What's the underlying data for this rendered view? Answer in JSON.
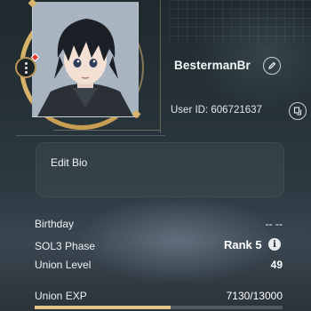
{
  "profile": {
    "username": "BestermanBr",
    "user_id": "User ID: 606721637",
    "edit_bio_label": "Edit Bio"
  },
  "stats": {
    "birthday_label": "Birthday",
    "birthday_value": "-- --",
    "phase_label": "SOL3 Phase",
    "phase_value": "Rank 5",
    "union_level_label": "Union Level",
    "union_level_value": "49",
    "union_exp_label": "Union EXP",
    "union_exp_value": "7130/13000",
    "union_exp_fraction": 0.548
  },
  "icons": {
    "options": "more-dots-icon",
    "rename": "pencil-icon",
    "copy_id": "copy-icon",
    "info": "info-icon"
  },
  "colors": {
    "accent_gold": "#d8b46a",
    "notification_red": "#e03a3a",
    "exp_fill": "#e2c489"
  }
}
